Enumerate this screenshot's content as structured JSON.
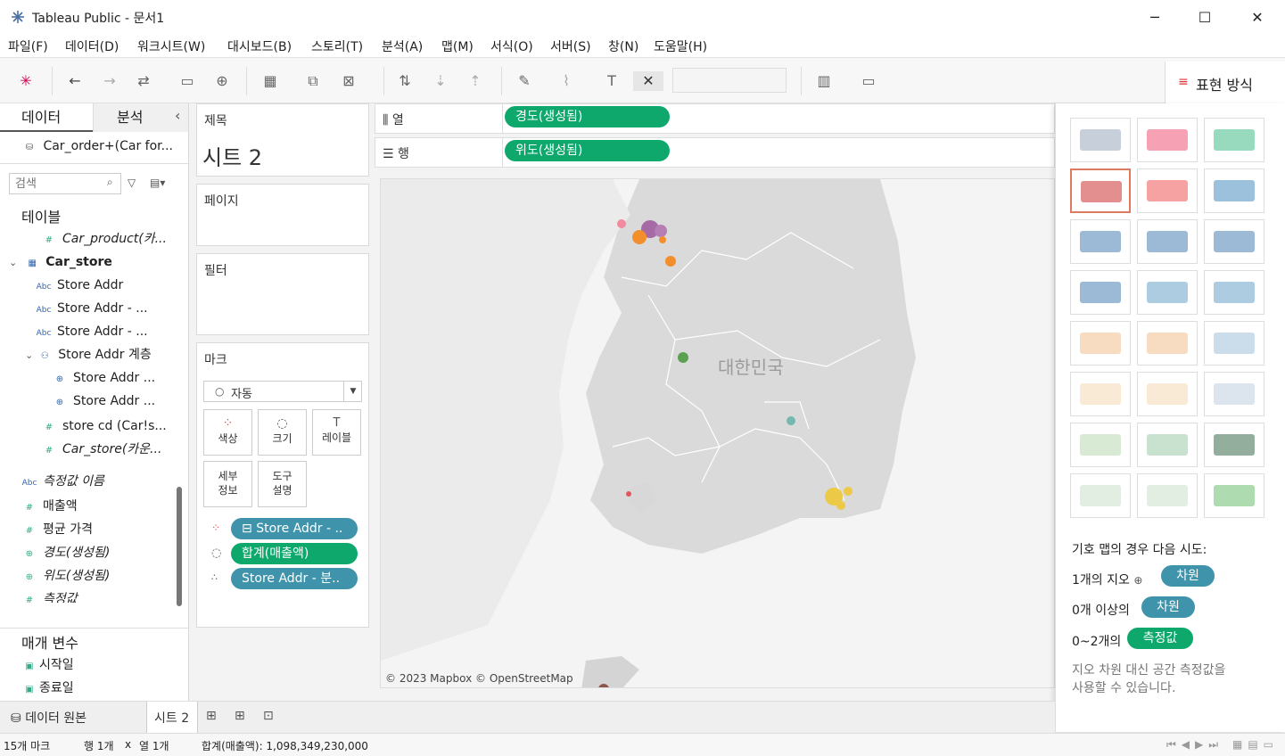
{
  "window": {
    "title": "Tableau Public - 문서1",
    "minimize": "─",
    "maximize": "☐",
    "close": "✕"
  },
  "menu": [
    "파일(F)",
    "데이터(D)",
    "워크시트(W)",
    "대시보드(B)",
    "스토리(T)",
    "분석(A)",
    "맵(M)",
    "서식(O)",
    "서버(S)",
    "창(N)",
    "도움말(H)"
  ],
  "toolbar": {
    "show_me_label": "표현 방식"
  },
  "left": {
    "tab_data": "데이터",
    "tab_analysis": "분석",
    "collapse": "‹",
    "datasource": "Car_order+(Car for...",
    "search_placeholder": "검색",
    "tables_heading": "테이블",
    "fields": [
      {
        "icon": "#",
        "label": "Car_product(카...",
        "italic": true
      },
      {
        "icon": "table",
        "label": "Car_store",
        "bold": true
      },
      {
        "icon": "Abc",
        "label": "Store Addr"
      },
      {
        "icon": "Abc",
        "label": "Store Addr - ..."
      },
      {
        "icon": "Abc",
        "label": "Store Addr - ..."
      },
      {
        "icon": "hier",
        "label": "Store Addr 계층"
      },
      {
        "icon": "geo",
        "label": "Store Addr ..."
      },
      {
        "icon": "geo",
        "label": "Store Addr ..."
      },
      {
        "icon": "#",
        "label": "store cd (Car!s..."
      },
      {
        "icon": "#",
        "label": "Car_store(카운...",
        "italic": true
      },
      {
        "icon": "Abc",
        "label": "측정값 이름",
        "italic": true
      },
      {
        "icon": "#",
        "label": "매출액"
      },
      {
        "icon": "#",
        "label": "평균 가격"
      },
      {
        "icon": "geo",
        "label": "경도(생성됨)",
        "italic": true
      },
      {
        "icon": "geo",
        "label": "위도(생성됨)",
        "italic": true
      },
      {
        "icon": "#",
        "label": "측정값",
        "italic": true
      }
    ],
    "params_heading": "매개 변수",
    "params": [
      {
        "label": "시작일"
      },
      {
        "label": "종료일"
      }
    ]
  },
  "cards": {
    "title_label": "제목",
    "sheet_title": "시트 2",
    "pages_label": "페이지",
    "filters_label": "필터",
    "marks_label": "마크",
    "mark_type": "자동",
    "mark_buttons": [
      "색상",
      "크기",
      "레이블",
      "세부\n정보",
      "도구\n설명"
    ],
    "mark_pills": [
      "Store Addr - ..",
      "합계(매출액)",
      "Store Addr - 분.."
    ]
  },
  "shelves": {
    "columns_label": "열",
    "rows_label": "행",
    "columns_pill": "경도(생성됨)",
    "rows_pill": "위도(생성됨)"
  },
  "map": {
    "country_label": "대한민국",
    "attribution": "© 2023 Mapbox © OpenStreetMap"
  },
  "showme": {
    "hint_title": "기호 맵의 경우 다음 시도:",
    "hint1": "1개의 지오",
    "hint2": "0개 이상의",
    "hint3": "0~2개의",
    "pill_dim": "차원",
    "pill_meas": "측정값",
    "note": "지오 차원 대신 공간 측정값을\n사용할 수 있습니다."
  },
  "tabs": {
    "datasource": "데이터 원본",
    "sheet": "시트 2"
  },
  "status": {
    "marks": "15개 마크",
    "rows": "행 1개",
    "x": "x",
    "cols": "열 1개",
    "sum": "합계(매출액): 1,098,349,230,000"
  },
  "colors": {
    "green_pill": "#0ea86c",
    "blue_pill": "#3f93aa",
    "selection": "#e07a5f"
  }
}
